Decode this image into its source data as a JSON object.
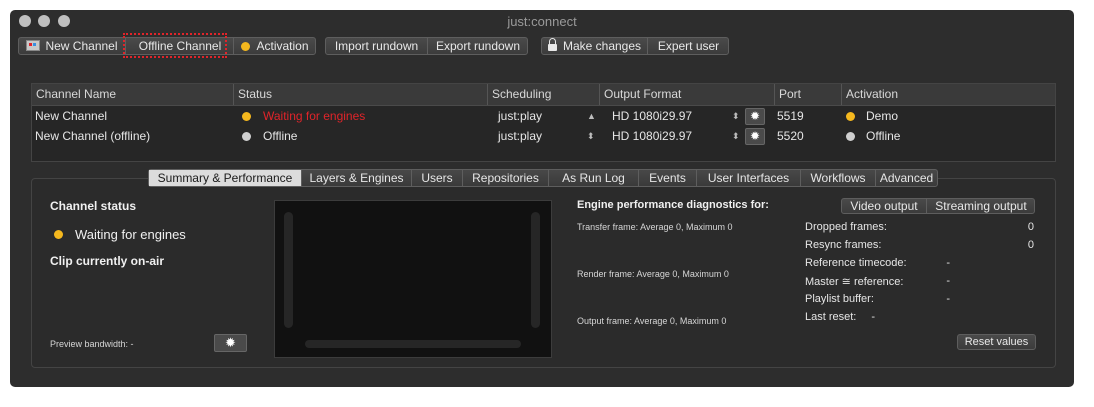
{
  "window": {
    "title": "just:connect"
  },
  "toolbar": {
    "new_channel": "New Channel",
    "offline_channel": "Offline Channel",
    "activation": "Activation",
    "import_rundown": "Import rundown",
    "export_rundown": "Export rundown",
    "make_changes": "Make changes",
    "expert_user": "Expert user"
  },
  "table": {
    "headers": [
      "Channel Name",
      "Status",
      "Scheduling",
      "Output Format",
      "Port",
      "Activation"
    ],
    "rows": [
      {
        "name": "New Channel",
        "status": "Waiting for engines",
        "status_color": "#e0242a",
        "dot": "yellow",
        "scheduling": "just:play",
        "format": "HD 1080i29.97",
        "port": "5519",
        "activation": "Demo",
        "activation_dot": "yellow"
      },
      {
        "name": "New Channel (offline)",
        "status": "Offline",
        "status_color": "#e6e6e6",
        "dot": "grey",
        "scheduling": "just:play",
        "format": "HD 1080i29.97",
        "port": "5520",
        "activation": "Offline",
        "activation_dot": "grey"
      }
    ]
  },
  "tabs": [
    "Summary & Performance",
    "Layers & Engines",
    "Users",
    "Repositories",
    "As Run Log",
    "Events",
    "User Interfaces",
    "Workflows",
    "Advanced"
  ],
  "summary": {
    "channel_status_title": "Channel status",
    "channel_status": "Waiting for engines",
    "clip_on_air": "Clip currently on-air",
    "preview_bandwidth": "Preview bandwidth:  -"
  },
  "performance": {
    "title": "Engine performance diagnostics for:",
    "video_output": "Video output",
    "streaming_output": "Streaming output",
    "transfer_frame": "Transfer frame: Average 0, Maximum 0",
    "render_frame": "Render frame: Average 0, Maximum 0",
    "output_frame": "Output frame: Average 0, Maximum 0",
    "stats": [
      {
        "label": "Dropped frames:",
        "value": "0"
      },
      {
        "label": "Resync frames:",
        "value": "0"
      },
      {
        "label": "Reference timecode:",
        "value": "-"
      },
      {
        "label": "Master ≅ reference:",
        "value": "-"
      },
      {
        "label": "Playlist buffer:",
        "value": "-"
      },
      {
        "label": "Last reset:",
        "value": "-"
      }
    ],
    "reset_values": "Reset values"
  },
  "colors": {
    "accent_red": "#e0242a",
    "status_yellow": "#f5b81e",
    "window_bg": "#2d2d2d"
  },
  "icons": [
    "close-icon",
    "minimize-icon",
    "zoom-icon",
    "new-channel-icon",
    "lock-icon",
    "gear-icon",
    "stepper-icon"
  ]
}
